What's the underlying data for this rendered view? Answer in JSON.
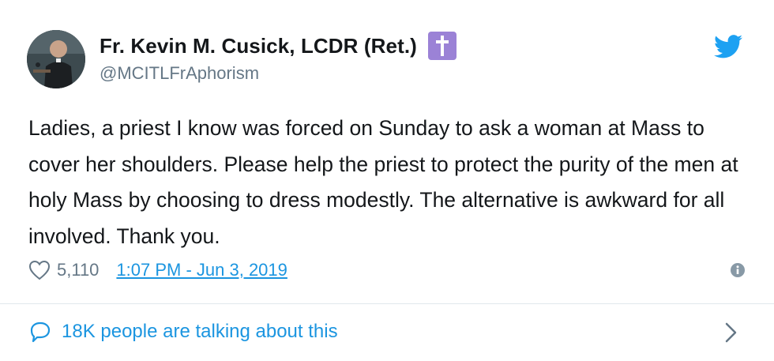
{
  "author": {
    "display_name": "Fr. Kevin M. Cusick, LCDR (Ret.)",
    "handle": "@MCITLFrAphorism",
    "badge_icon": "latin-cross-icon",
    "badge_color": "#9b82d6"
  },
  "tweet": {
    "text": "Ladies, a priest I know was forced on Sunday to ask a woman at Mass to cover her shoulders. Please help the priest to protect the purity of the men at holy Mass by choosing to dress modestly. The alternative is awkward for all involved. Thank you.",
    "like_count": "5,110",
    "timestamp": "1:07 PM - Jun 3, 2019"
  },
  "conversation": {
    "label": "18K people are talking about this"
  },
  "colors": {
    "link_blue": "#1b95e0",
    "twitter_blue": "#1da1f2",
    "muted_gray": "#657786",
    "divider": "#e1e8ed"
  },
  "icons": {
    "brand": "twitter-bird-icon",
    "like": "heart-outline-icon",
    "info": "info-icon",
    "conversation": "speech-bubble-icon",
    "chevron": "chevron-right-icon"
  }
}
